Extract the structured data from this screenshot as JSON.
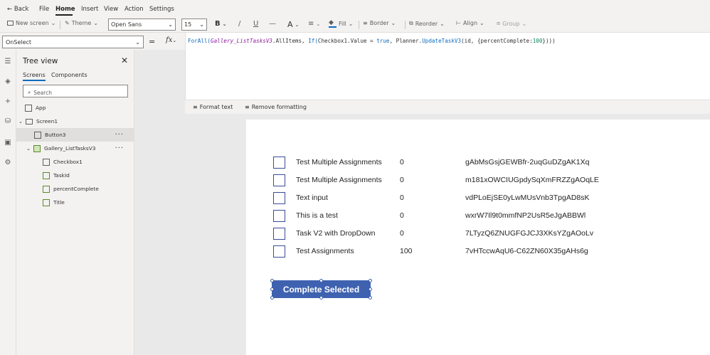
{
  "menu": {
    "back": "Back",
    "items": [
      "File",
      "Home",
      "Insert",
      "View",
      "Action",
      "Settings"
    ],
    "active": "Home"
  },
  "toolbar": {
    "new_screen": "New screen",
    "theme": "Theme",
    "font": "Open Sans",
    "font_size": "15",
    "bold": "B",
    "italic": "/",
    "underline": "U",
    "strike": "—",
    "text_color": "A",
    "fill": "Fill",
    "border": "Border",
    "reorder": "Reorder",
    "align": "Align",
    "group": "Group"
  },
  "formula_bar": {
    "property": "OnSelect",
    "equals": "=",
    "fx": "fx",
    "formula_parts": [
      {
        "t": "ForAll(",
        "c": "kw"
      },
      {
        "t": "Gallery_ListTasksV3",
        "c": "ctl"
      },
      {
        "t": ".AllItems, ",
        "c": ""
      },
      {
        "t": "If(",
        "c": "kw"
      },
      {
        "t": "Checkbox1.Value = ",
        "c": ""
      },
      {
        "t": "true",
        "c": "kw"
      },
      {
        "t": ", Planner.",
        "c": ""
      },
      {
        "t": "UpdateTaskV3",
        "c": "kw"
      },
      {
        "t": "(id, {percentComplete:",
        "c": ""
      },
      {
        "t": "100",
        "c": "num"
      },
      {
        "t": "})))",
        "c": ""
      }
    ]
  },
  "format_bar": {
    "format_text": "Format text",
    "remove_formatting": "Remove formatting"
  },
  "tree": {
    "title": "Tree view",
    "tabs": [
      "Screens",
      "Components"
    ],
    "active_tab": "Screens",
    "search_placeholder": "Search",
    "items": [
      {
        "label": "App",
        "depth": 0
      },
      {
        "label": "Screen1",
        "depth": 0
      },
      {
        "label": "Button3",
        "depth": 1,
        "selected": true
      },
      {
        "label": "Gallery_ListTasksV3",
        "depth": 1
      },
      {
        "label": "Checkbox1",
        "depth": 2
      },
      {
        "label": "TaskId",
        "depth": 2
      },
      {
        "label": "percentComplete",
        "depth": 2
      },
      {
        "label": "Title",
        "depth": 2
      }
    ]
  },
  "gallery": {
    "rows": [
      {
        "title": "Test Multiple Assignments",
        "percent": "0",
        "id": "gAbMsGsjGEWBfr-2uqGuDZgAK1Xq"
      },
      {
        "title": "Test Multiple Assignments",
        "percent": "0",
        "id": "m181xOWCIUGpdySqXmFRZZgAOqLE"
      },
      {
        "title": "Text input",
        "percent": "0",
        "id": "vdPLoEjSE0yLwMUsVnb3TpgAD8sK"
      },
      {
        "title": "This is a test",
        "percent": "0",
        "id": "wxrW7Il9t0mmfNP2UsR5eJgABBWl"
      },
      {
        "title": "Task V2 with DropDown",
        "percent": "0",
        "id": "7LTyzQ6ZNUGFGJCJ3XKsYZgAOoLv"
      },
      {
        "title": "Test Assignments",
        "percent": "100",
        "id": "7vHTccwAqU6-C62ZN60X35gAHs6g"
      }
    ]
  },
  "button": {
    "label": "Complete Selected"
  },
  "colors": {
    "accent": "#3f62b0",
    "checkbox_border": "#3b4c97",
    "keyword": "#0e6abf"
  }
}
